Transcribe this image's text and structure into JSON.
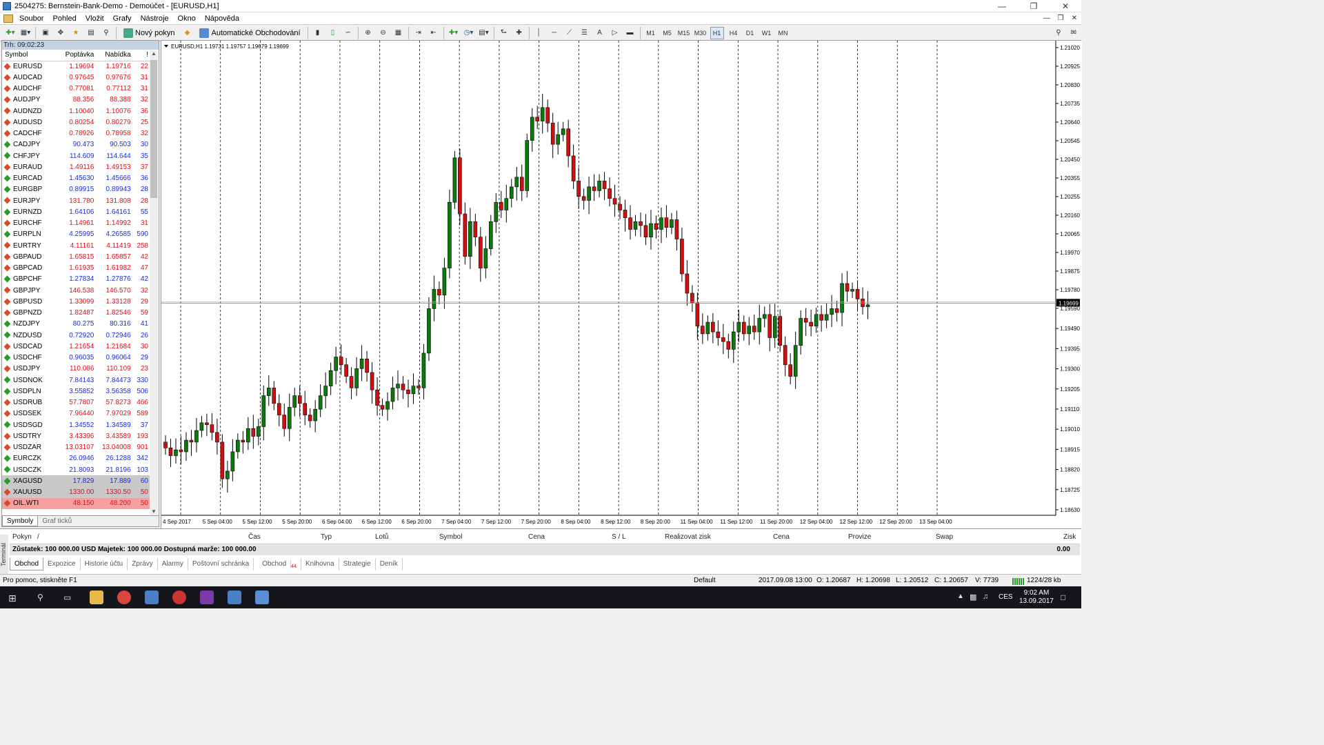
{
  "window": {
    "title": "2504275: Bernstein-Bank-Demo - Demoúčet - [EURUSD,H1]"
  },
  "menu": [
    "Soubor",
    "Pohled",
    "Vložit",
    "Grafy",
    "Nástroje",
    "Okno",
    "Nápověda"
  ],
  "toolbar": {
    "new_order": "Nový pokyn",
    "auto_trading": "Automatické Obchodování",
    "timeframes": [
      "M1",
      "M5",
      "M15",
      "M30",
      "H1",
      "H4",
      "D1",
      "W1",
      "MN"
    ],
    "active_timeframe": "H1"
  },
  "market_watch": {
    "header": "Trh: 09:02:23",
    "columns": [
      "Symbol",
      "Poptávka",
      "Nabídka",
      "!"
    ],
    "rows": [
      {
        "symbol": "EURUSD",
        "bid": "1.19694",
        "ask": "1.19716",
        "spread": "22",
        "dir": "dn"
      },
      {
        "symbol": "AUDCAD",
        "bid": "0.97645",
        "ask": "0.97676",
        "spread": "31",
        "dir": "dn"
      },
      {
        "symbol": "AUDCHF",
        "bid": "0.77081",
        "ask": "0.77112",
        "spread": "31",
        "dir": "dn"
      },
      {
        "symbol": "AUDJPY",
        "bid": "88.356",
        "ask": "88.388",
        "spread": "32",
        "dir": "dn"
      },
      {
        "symbol": "AUDNZD",
        "bid": "1.10040",
        "ask": "1.10076",
        "spread": "36",
        "dir": "dn"
      },
      {
        "symbol": "AUDUSD",
        "bid": "0.80254",
        "ask": "0.80279",
        "spread": "25",
        "dir": "dn"
      },
      {
        "symbol": "CADCHF",
        "bid": "0.78926",
        "ask": "0.78958",
        "spread": "32",
        "dir": "dn"
      },
      {
        "symbol": "CADJPY",
        "bid": "90.473",
        "ask": "90.503",
        "spread": "30",
        "dir": "up"
      },
      {
        "symbol": "CHFJPY",
        "bid": "114.609",
        "ask": "114.644",
        "spread": "35",
        "dir": "up"
      },
      {
        "symbol": "EURAUD",
        "bid": "1.49116",
        "ask": "1.49153",
        "spread": "37",
        "dir": "dn"
      },
      {
        "symbol": "EURCAD",
        "bid": "1.45630",
        "ask": "1.45666",
        "spread": "36",
        "dir": "up"
      },
      {
        "symbol": "EURGBP",
        "bid": "0.89915",
        "ask": "0.89943",
        "spread": "28",
        "dir": "up"
      },
      {
        "symbol": "EURJPY",
        "bid": "131.780",
        "ask": "131.808",
        "spread": "28",
        "dir": "dn"
      },
      {
        "symbol": "EURNZD",
        "bid": "1.64106",
        "ask": "1.64161",
        "spread": "55",
        "dir": "up"
      },
      {
        "symbol": "EURCHF",
        "bid": "1.14961",
        "ask": "1.14992",
        "spread": "31",
        "dir": "dn"
      },
      {
        "symbol": "EURPLN",
        "bid": "4.25995",
        "ask": "4.26585",
        "spread": "590",
        "dir": "up"
      },
      {
        "symbol": "EURTRY",
        "bid": "4.11161",
        "ask": "4.11419",
        "spread": "258",
        "dir": "dn"
      },
      {
        "symbol": "GBPAUD",
        "bid": "1.65815",
        "ask": "1.65857",
        "spread": "42",
        "dir": "dn"
      },
      {
        "symbol": "GBPCAD",
        "bid": "1.61935",
        "ask": "1.61982",
        "spread": "47",
        "dir": "dn"
      },
      {
        "symbol": "GBPCHF",
        "bid": "1.27834",
        "ask": "1.27876",
        "spread": "42",
        "dir": "up"
      },
      {
        "symbol": "GBPJPY",
        "bid": "146.538",
        "ask": "146.570",
        "spread": "32",
        "dir": "dn"
      },
      {
        "symbol": "GBPUSD",
        "bid": "1.33099",
        "ask": "1.33128",
        "spread": "29",
        "dir": "dn"
      },
      {
        "symbol": "GBPNZD",
        "bid": "1.82487",
        "ask": "1.82546",
        "spread": "59",
        "dir": "dn"
      },
      {
        "symbol": "NZDJPY",
        "bid": "80.275",
        "ask": "80.316",
        "spread": "41",
        "dir": "up"
      },
      {
        "symbol": "NZDUSD",
        "bid": "0.72920",
        "ask": "0.72946",
        "spread": "26",
        "dir": "up"
      },
      {
        "symbol": "USDCAD",
        "bid": "1.21654",
        "ask": "1.21684",
        "spread": "30",
        "dir": "dn"
      },
      {
        "symbol": "USDCHF",
        "bid": "0.96035",
        "ask": "0.96064",
        "spread": "29",
        "dir": "up"
      },
      {
        "symbol": "USDJPY",
        "bid": "110.086",
        "ask": "110.109",
        "spread": "23",
        "dir": "dn"
      },
      {
        "symbol": "USDNOK",
        "bid": "7.84143",
        "ask": "7.84473",
        "spread": "330",
        "dir": "up"
      },
      {
        "symbol": "USDPLN",
        "bid": "3.55852",
        "ask": "3.56358",
        "spread": "506",
        "dir": "up"
      },
      {
        "symbol": "USDRUB",
        "bid": "57.7807",
        "ask": "57.8273",
        "spread": "466",
        "dir": "dn"
      },
      {
        "symbol": "USDSEK",
        "bid": "7.96440",
        "ask": "7.97029",
        "spread": "589",
        "dir": "dn"
      },
      {
        "symbol": "USDSGD",
        "bid": "1.34552",
        "ask": "1.34589",
        "spread": "37",
        "dir": "up"
      },
      {
        "symbol": "USDTRY",
        "bid": "3.43396",
        "ask": "3.43589",
        "spread": "193",
        "dir": "dn"
      },
      {
        "symbol": "USDZAR",
        "bid": "13.03107",
        "ask": "13.04008",
        "spread": "901",
        "dir": "dn"
      },
      {
        "symbol": "EURCZK",
        "bid": "26.0946",
        "ask": "26.1288",
        "spread": "342",
        "dir": "up"
      },
      {
        "symbol": "USDCZK",
        "bid": "21.8093",
        "ask": "21.8196",
        "spread": "103",
        "dir": "up"
      },
      {
        "symbol": "XAGUSD",
        "bid": "17.829",
        "ask": "17.889",
        "spread": "60",
        "dir": "up",
        "hl": "hl1"
      },
      {
        "symbol": "XAUUSD",
        "bid": "1330.00",
        "ask": "1330.50",
        "spread": "50",
        "dir": "dn",
        "hl": "hl1"
      },
      {
        "symbol": "OIL.WTI",
        "bid": "48.150",
        "ask": "48.200",
        "spread": "50",
        "dir": "dn",
        "hl": "hl2"
      }
    ],
    "tabs": [
      "Symboly",
      "Graf ticků"
    ]
  },
  "chart_data": {
    "type": "candlestick",
    "info": "EURUSD,H1  1.19731 1.19757 1.19679 1.19699",
    "current_price": "1.19699",
    "ylim": [
      1.1863,
      1.2102
    ],
    "y_ticks": [
      "1.21020",
      "1.20925",
      "1.20830",
      "1.20735",
      "1.20640",
      "1.20545",
      "1.20450",
      "1.20355",
      "1.20255",
      "1.20160",
      "1.20065",
      "1.19970",
      "1.19875",
      "1.19780",
      "1.19590",
      "1.19490",
      "1.19395",
      "1.19300",
      "1.19205",
      "1.19110",
      "1.19010",
      "1.18915",
      "1.18820",
      "1.18725",
      "1.18630"
    ],
    "x_ticks": [
      "4 Sep 2017",
      "5 Sep 04:00",
      "5 Sep 12:00",
      "5 Sep 20:00",
      "6 Sep 04:00",
      "6 Sep 12:00",
      "6 Sep 20:00",
      "7 Sep 04:00",
      "7 Sep 12:00",
      "7 Sep 20:00",
      "8 Sep 04:00",
      "8 Sep 12:00",
      "8 Sep 20:00",
      "11 Sep 04:00",
      "11 Sep 12:00",
      "11 Sep 20:00",
      "12 Sep 04:00",
      "12 Sep 12:00",
      "12 Sep 20:00",
      "13 Sep 04:00"
    ],
    "series_close": [
      1.1895,
      1.1891,
      1.1894,
      1.1893,
      1.1899,
      1.1898,
      1.1904,
      1.1908,
      1.1907,
      1.1903,
      1.1898,
      1.1879,
      1.1883,
      1.1893,
      1.1899,
      1.1898,
      1.1905,
      1.1901,
      1.1906,
      1.1922,
      1.1926,
      1.1918,
      1.1912,
      1.1905,
      1.1916,
      1.1922,
      1.1918,
      1.1912,
      1.1909,
      1.1915,
      1.1922,
      1.1927,
      1.1935,
      1.1942,
      1.1938,
      1.1932,
      1.1926,
      1.1936,
      1.1941,
      1.1934,
      1.1925,
      1.1917,
      1.1915,
      1.1919,
      1.1926,
      1.1928,
      1.1925,
      1.1923,
      1.1927,
      1.1926,
      1.1944,
      1.1967,
      1.1977,
      1.1974,
      1.1988,
      1.2022,
      1.2045,
      1.2016,
      1.1994,
      1.2012,
      1.2004,
      1.1988,
      1.1998,
      1.2012,
      1.2022,
      1.2018,
      1.2024,
      1.203,
      1.2035,
      1.2028,
      1.2054,
      1.2066,
      1.2064,
      1.2071,
      1.2063,
      1.2052,
      1.2057,
      1.206,
      1.2046,
      1.2033,
      1.2025,
      1.2023,
      1.203,
      1.2028,
      1.2033,
      1.2029,
      1.2024,
      1.2021,
      1.2018,
      1.2014,
      1.2008,
      1.2012,
      1.201,
      1.2004,
      1.2011,
      1.2008,
      1.2014,
      1.2009,
      1.2013,
      1.2003,
      1.1985,
      1.1975,
      1.197,
      1.1958,
      1.1954,
      1.196,
      1.1955,
      1.1952,
      1.195,
      1.1946,
      1.1955,
      1.196,
      1.1954,
      1.1958,
      1.1955,
      1.1962,
      1.1964,
      1.1952,
      1.1963,
      1.1948,
      1.1938,
      1.1932,
      1.1948,
      1.1962,
      1.196,
      1.1958,
      1.1964,
      1.1961,
      1.1964,
      1.1967,
      1.1965,
      1.198,
      1.1976,
      1.1977,
      1.1972,
      1.1968,
      1.1969
    ]
  },
  "terminal": {
    "label": "Terminál",
    "columns": [
      "Pokyn",
      "/",
      "Čas",
      "Typ",
      "Lotů",
      "Symbol",
      "Cena",
      "S / L",
      "Realizovat zisk",
      "Cena",
      "Provize",
      "Swap",
      "Zisk"
    ],
    "balance": "Zůstatek: 100 000.00 USD  Majetek: 100 000.00  Dostupná marže: 100 000.00",
    "balance_value": "0.00",
    "tabs": [
      "Obchod",
      "Expozice",
      "Historie účtu",
      "Zprávy",
      "Alarmy",
      "Poštovní schránka",
      "Obchod",
      "Knihovna",
      "Strategie",
      "Deník"
    ],
    "tab_badge": "44"
  },
  "status": {
    "help": "Pro pomoc, stiskněte F1",
    "profile": "Default",
    "time": "2017.09.08 13:00",
    "open": "O: 1.20687",
    "high": "H: 1.20698",
    "low": "L: 1.20512",
    "close": "C: 1.20657",
    "volume": "V: 7739",
    "traffic": "1224/28 kb"
  },
  "taskbar": {
    "lang": "CES",
    "time": "9:02 AM",
    "date": "13.09.2017"
  }
}
